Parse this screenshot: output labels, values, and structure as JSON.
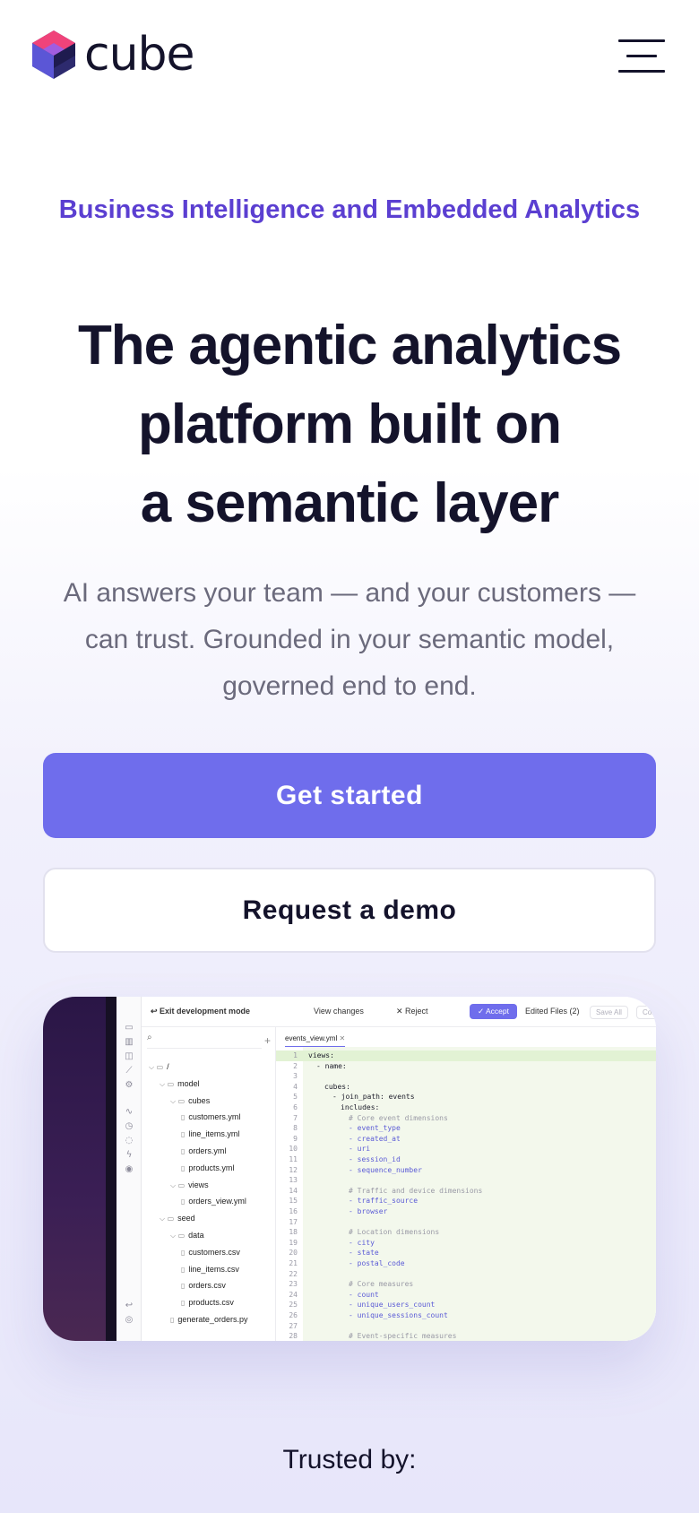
{
  "header": {
    "logo_text": "cube",
    "logo_icon": "cube-logo-icon",
    "menu_icon": "hamburger-menu-icon"
  },
  "hero": {
    "eyebrow": "Business Intelligence and Embedded Analytics",
    "headline_lines": [
      "The agentic analytics",
      "platform built on",
      "a semantic layer"
    ],
    "subtitle": "AI answers your team — and your customers — can trust. Grounded in your semantic model, governed end to end.",
    "primary_cta": "Get started",
    "secondary_cta": "Request a demo"
  },
  "colors": {
    "accent": "#6f6dec",
    "eyebrow": "#5b3fd1",
    "ink": "#14132b",
    "muted": "#6b6a7c"
  },
  "product_screenshot": {
    "toolbar": {
      "exit": "↩ Exit development mode",
      "view_changes": "View changes",
      "reject": "Reject",
      "accept": "Accept",
      "edited_files": "Edited Files (2)",
      "save_all": "Save All",
      "commit_sync": "Commit & Sync"
    },
    "file_tree": [
      {
        "depth": 0,
        "kind": "folder",
        "label": "/"
      },
      {
        "depth": 1,
        "kind": "folder",
        "label": "model"
      },
      {
        "depth": 2,
        "kind": "folder",
        "label": "cubes"
      },
      {
        "depth": 3,
        "kind": "file",
        "label": "customers.yml"
      },
      {
        "depth": 3,
        "kind": "file",
        "label": "line_items.yml"
      },
      {
        "depth": 3,
        "kind": "file",
        "label": "orders.yml"
      },
      {
        "depth": 3,
        "kind": "file",
        "label": "products.yml"
      },
      {
        "depth": 2,
        "kind": "folder",
        "label": "views"
      },
      {
        "depth": 3,
        "kind": "file",
        "label": "orders_view.yml"
      },
      {
        "depth": 1,
        "kind": "folder",
        "label": "seed"
      },
      {
        "depth": 2,
        "kind": "folder",
        "label": "data"
      },
      {
        "depth": 3,
        "kind": "file",
        "label": "customers.csv"
      },
      {
        "depth": 3,
        "kind": "file",
        "label": "line_items.csv"
      },
      {
        "depth": 3,
        "kind": "file",
        "label": "orders.csv"
      },
      {
        "depth": 3,
        "kind": "file",
        "label": "products.csv"
      },
      {
        "depth": 2,
        "kind": "file",
        "label": "generate_orders.py"
      }
    ],
    "editor_tab": "events_view.yml",
    "code_lines": [
      {
        "n": "1",
        "t": "views:",
        "k": "key",
        "i": 0
      },
      {
        "n": "2",
        "t": "- name:",
        "k": "key",
        "i": 1
      },
      {
        "n": "3",
        "t": "",
        "k": "key",
        "i": 0
      },
      {
        "n": "4",
        "t": "cubes:",
        "k": "key",
        "i": 2
      },
      {
        "n": "5",
        "t": "- join_path: events",
        "k": "mix",
        "i": 3
      },
      {
        "n": "6",
        "t": "includes:",
        "k": "key",
        "i": 4
      },
      {
        "n": "7",
        "t": "# Core event dimensions",
        "k": "cmt",
        "i": 5
      },
      {
        "n": "8",
        "t": "- event_type",
        "k": "val",
        "i": 5
      },
      {
        "n": "9",
        "t": "- created_at",
        "k": "val",
        "i": 5
      },
      {
        "n": "10",
        "t": "- uri",
        "k": "val",
        "i": 5
      },
      {
        "n": "11",
        "t": "- session_id",
        "k": "val",
        "i": 5
      },
      {
        "n": "12",
        "t": "- sequence_number",
        "k": "val",
        "i": 5
      },
      {
        "n": "13",
        "t": "",
        "k": "key",
        "i": 0
      },
      {
        "n": "14",
        "t": "# Traffic and device dimensions",
        "k": "cmt",
        "i": 5
      },
      {
        "n": "15",
        "t": "- traffic_source",
        "k": "val",
        "i": 5
      },
      {
        "n": "16",
        "t": "- browser",
        "k": "val",
        "i": 5
      },
      {
        "n": "17",
        "t": "",
        "k": "key",
        "i": 0
      },
      {
        "n": "18",
        "t": "# Location dimensions",
        "k": "cmt",
        "i": 5
      },
      {
        "n": "19",
        "t": "- city",
        "k": "val",
        "i": 5
      },
      {
        "n": "20",
        "t": "- state",
        "k": "val",
        "i": 5
      },
      {
        "n": "21",
        "t": "- postal_code",
        "k": "val",
        "i": 5
      },
      {
        "n": "22",
        "t": "",
        "k": "key",
        "i": 0
      },
      {
        "n": "23",
        "t": "# Core measures",
        "k": "cmt",
        "i": 5
      },
      {
        "n": "24",
        "t": "- count",
        "k": "val",
        "i": 5
      },
      {
        "n": "25",
        "t": "- unique_users_count",
        "k": "val",
        "i": 5
      },
      {
        "n": "26",
        "t": "- unique_sessions_count",
        "k": "val",
        "i": 5
      },
      {
        "n": "27",
        "t": "",
        "k": "key",
        "i": 0
      },
      {
        "n": "28",
        "t": "# Event-specific measures",
        "k": "cmt",
        "i": 5
      }
    ]
  },
  "trusted": {
    "label": "Trusted by:"
  }
}
